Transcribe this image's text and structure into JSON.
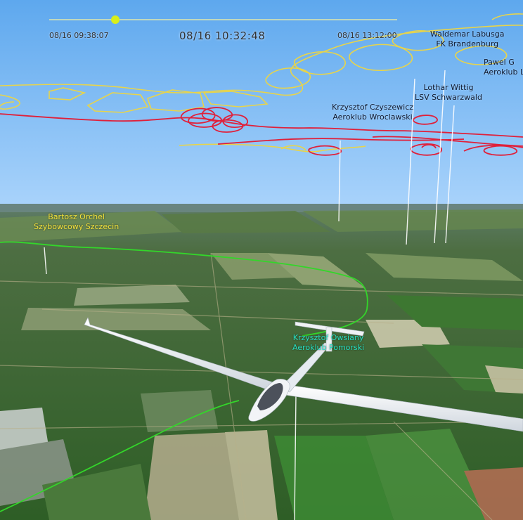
{
  "timeline": {
    "start_time": "08/16 09:38:07",
    "current_time": "08/16 10:32:48",
    "end_time": "08/16 13:12:00",
    "position": 0.19
  },
  "pilots": [
    {
      "name": "Waldemar Labusga",
      "club": "FK Brandenburg"
    },
    {
      "name": "Pawel G",
      "club": "Aeroklub L"
    },
    {
      "name": "Lothar Wittig",
      "club": "LSV Schwarzwald"
    },
    {
      "name": "Krzysztof Czyszewicz",
      "club": "Aeroklub Wroclawski"
    },
    {
      "name": "Bartosz Orchel",
      "club": "Szybowcowy Szczecin"
    },
    {
      "name": "Krzysztof Owsiany",
      "club": "Aeroklub Pomorski"
    }
  ],
  "colors": {
    "sky_top": "#5ea8ee",
    "sky_bottom": "#a9d3fb",
    "track_yellow": "#e8d44a",
    "track_red": "#e0203a",
    "track_green": "#33d62a",
    "label_cyan": "#27e0c3",
    "timeline_marker": "#d8ee1a"
  }
}
